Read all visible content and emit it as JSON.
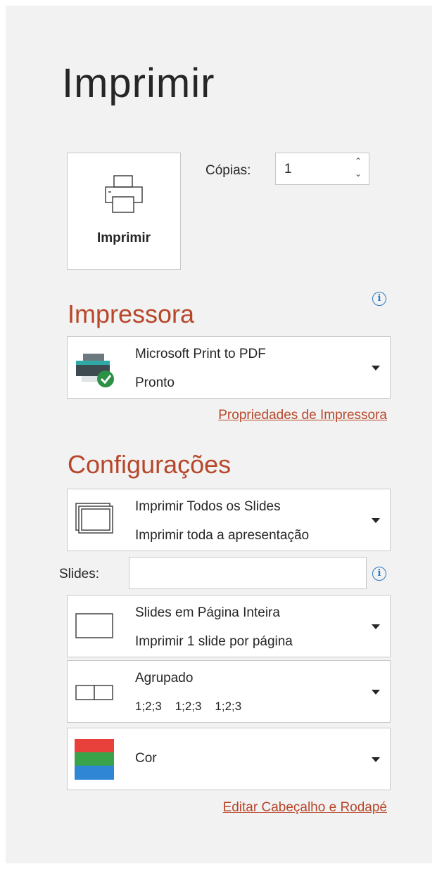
{
  "title": "Imprimir",
  "print_button": {
    "label": "Imprimir",
    "icon": "printer-icon"
  },
  "copies": {
    "label": "Cópias:",
    "value": "1"
  },
  "printer_section": {
    "title": "Impressora",
    "printer": {
      "name": "Microsoft Print to PDF",
      "status": "Pronto",
      "icon": "printer-ready-icon"
    },
    "properties_link": "Propriedades de Impressora"
  },
  "settings_section": {
    "title": "Configurações",
    "slides_range": {
      "line1": "Imprimir Todos os Slides",
      "line2": "Imprimir toda a apresentação",
      "icon": "all-slides-icon"
    },
    "slides_field": {
      "label": "Slides:",
      "value": ""
    },
    "layout": {
      "line1": "Slides em Página Inteira",
      "line2": "Imprimir 1 slide por página",
      "icon": "full-page-slide-icon"
    },
    "collation": {
      "line1": "Agrupado",
      "line2": "1;2;3    1;2;3    1;2;3",
      "icon": "collated-icon"
    },
    "color": {
      "label": "Cor",
      "icon": "color-icon",
      "colors": [
        "#e8413c",
        "#3aa34a",
        "#2e86d4"
      ]
    },
    "header_footer_link": "Editar Cabeçalho e Rodapé"
  },
  "colors": {
    "accent": "#b7472a",
    "info": "#2b79c2",
    "panel_bg": "#f2f2f2"
  }
}
